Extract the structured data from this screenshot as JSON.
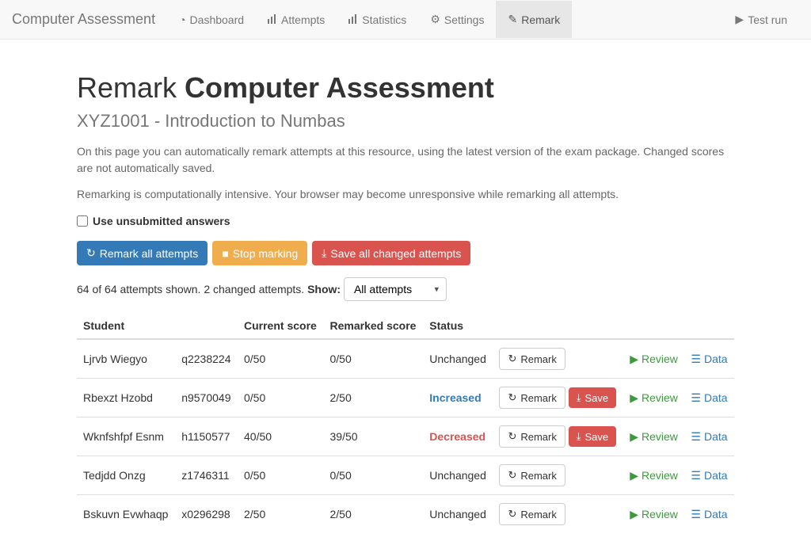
{
  "nav": {
    "brand": "Computer Assessment",
    "items": [
      {
        "label": "Dashboard",
        "icon": "dashboard"
      },
      {
        "label": "Attempts",
        "icon": "stats"
      },
      {
        "label": "Statistics",
        "icon": "stats"
      },
      {
        "label": "Settings",
        "icon": "cog"
      },
      {
        "label": "Remark",
        "icon": "pencil",
        "active": true
      }
    ],
    "test_run": "Test run"
  },
  "header": {
    "title_prefix": "Remark",
    "title_bold": "Computer Assessment",
    "subtitle": "XYZ1001 - Introduction to Numbas",
    "intro1": "On this page you can automatically remark attempts at this resource, using the latest version of the exam package. Changed scores are not automatically saved.",
    "intro2": "Remarking is computationally intensive. Your browser may become unresponsive while remarking all attempts."
  },
  "controls": {
    "use_unsubmitted": "Use unsubmitted answers",
    "remark_all": "Remark all attempts",
    "stop_marking": "Stop marking",
    "save_all": "Save all changed attempts"
  },
  "filter": {
    "summary": "64 of 64 attempts shown. 2 changed attempts.",
    "show_label": "Show:",
    "selected": "All attempts"
  },
  "table": {
    "headers": {
      "student": "Student",
      "id": "",
      "current": "Current score",
      "remarked": "Remarked score",
      "status": "Status"
    },
    "remark_btn": "Remark",
    "save_btn": "Save",
    "review_link": "Review",
    "data_link": "Data",
    "rows": [
      {
        "student": "Ljrvb Wiegyo",
        "id": "q2238224",
        "current": "0/50",
        "remarked": "0/50",
        "status": "Unchanged",
        "status_class": "unchanged",
        "save": false
      },
      {
        "student": "Rbexzt Hzobd",
        "id": "n9570049",
        "current": "0/50",
        "remarked": "2/50",
        "status": "Increased",
        "status_class": "increased",
        "save": true
      },
      {
        "student": "Wknfshfpf Esnm",
        "id": "h1150577",
        "current": "40/50",
        "remarked": "39/50",
        "status": "Decreased",
        "status_class": "decreased",
        "save": true
      },
      {
        "student": "Tedjdd Onzg",
        "id": "z1746311",
        "current": "0/50",
        "remarked": "0/50",
        "status": "Unchanged",
        "status_class": "unchanged",
        "save": false
      },
      {
        "student": "Bskuvn Evwhaqp",
        "id": "x0296298",
        "current": "2/50",
        "remarked": "2/50",
        "status": "Unchanged",
        "status_class": "unchanged",
        "save": false
      }
    ]
  }
}
